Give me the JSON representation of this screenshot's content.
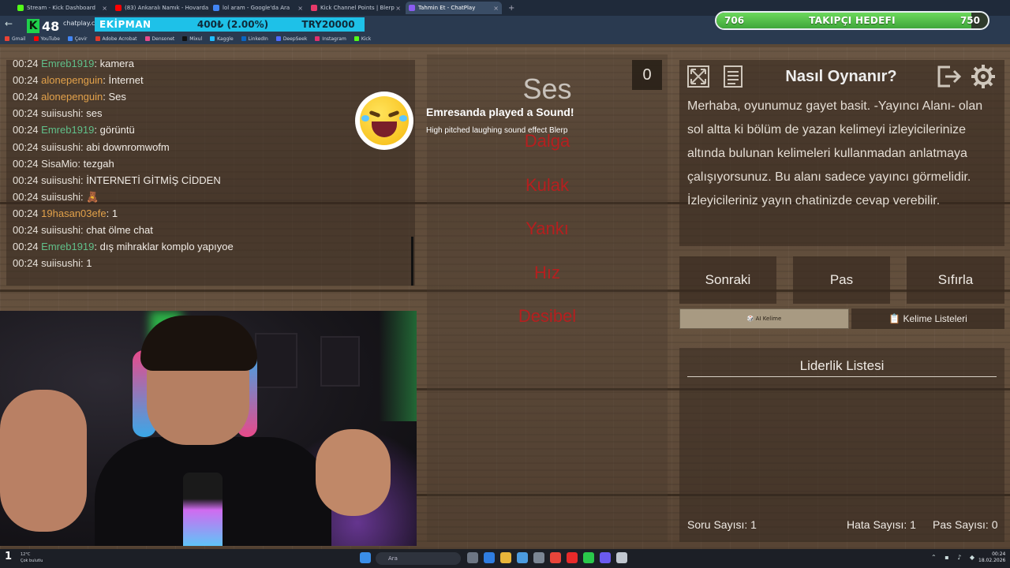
{
  "browser": {
    "tabs": [
      {
        "label": "Stream - Kick Dashboard",
        "color": "#53fc18"
      },
      {
        "label": "(83) Ankaralı Namık - Hovarda",
        "color": "#ff0000"
      },
      {
        "label": "lol aram - Google'da Ara",
        "color": "#4285f4"
      },
      {
        "label": "Kick Channel Points | Blerp",
        "color": "#e83a6a"
      },
      {
        "label": "Tahmin Et - ChatPlay",
        "color": "#8a5cf0",
        "active": true
      }
    ],
    "new_tab": "+",
    "url": "chatplay.com",
    "bookmarks": [
      {
        "label": "Gmail",
        "color": "#ea4335"
      },
      {
        "label": "YouTube",
        "color": "#ff0000"
      },
      {
        "label": "Çevir",
        "color": "#4285f4"
      },
      {
        "label": "Adobe Acrobat",
        "color": "#e03a2a"
      },
      {
        "label": "Densonet",
        "color": "#e84a8a"
      },
      {
        "label": "Mixul",
        "color": "#111111"
      },
      {
        "label": "Kaggle",
        "color": "#20beff"
      },
      {
        "label": "LinkedIn",
        "color": "#0a66c2"
      },
      {
        "label": "DeepSeek",
        "color": "#4d6bfe"
      },
      {
        "label": "Instagram",
        "color": "#e1306c"
      },
      {
        "label": "Kick",
        "color": "#53fc18"
      }
    ]
  },
  "overlay": {
    "kick_count": "48",
    "ekipman_label": "EKİPMAN",
    "ekipman_progress": "400₺ (2.00%)",
    "ekipman_goal": "TRY20000",
    "goal": {
      "current": "706",
      "caption": "TAKIPÇI HEDEFI",
      "target": "750",
      "fraction": 0.94
    }
  },
  "chat": [
    {
      "time": "00:24",
      "user": "Emreb1919",
      "color": "green",
      "text": "kamera"
    },
    {
      "time": "00:24",
      "user": "alonepenguin",
      "color": "orange",
      "text": "İnternet"
    },
    {
      "time": "00:24",
      "user": "alonepenguin",
      "color": "orange",
      "text": "Ses"
    },
    {
      "time": "00:24",
      "user": "suiisushi",
      "color": "grey",
      "text": "ses"
    },
    {
      "time": "00:24",
      "user": "Emreb1919",
      "color": "green",
      "text": "görüntü"
    },
    {
      "time": "00:24",
      "user": "suiisushi",
      "color": "grey",
      "text": "abi downromwofm"
    },
    {
      "time": "00:24",
      "user": "SisaMio",
      "color": "grey",
      "text": "tezgah"
    },
    {
      "time": "00:24",
      "user": "suiisushi",
      "color": "grey",
      "text": "İNTERNETİ GİTMİŞ CİDDEN"
    },
    {
      "time": "00:24",
      "user": "suiisushi",
      "color": "grey",
      "text": "🧸"
    },
    {
      "time": "00:24",
      "user": "19hasan03efe",
      "color": "orange",
      "text": "1"
    },
    {
      "time": "00:24",
      "user": "suiisushi",
      "color": "grey",
      "text": "chat ölme chat"
    },
    {
      "time": "00:24",
      "user": "Emreb1919",
      "color": "green",
      "text": "dış mihraklar komplo yapıyoe"
    },
    {
      "time": "00:24",
      "user": "suiisushi",
      "color": "grey",
      "text": "1"
    }
  ],
  "game": {
    "word": "Ses",
    "score": "0",
    "forbidden": [
      "Dalga",
      "Kulak",
      "Yankı",
      "Hız",
      "Desibel"
    ]
  },
  "notification": {
    "title": "Emresanda played a Sound!",
    "subtitle": "High pitched laughing sound effect Blerp"
  },
  "how_to": {
    "title": "Nasıl Oynanır?",
    "text": "Merhaba, oyunumuz gayet basit. -Yayıncı Alanı- olan sol altta ki bölüm de yazan kelimeyi izleyicilerinize altında bulunan kelimeleri kullanmadan anlatmaya çalışıyorsunuz. Bu alanı sadece yayıncı görmelidir. İzleyicileriniz yayın chatinizde cevap verebilir."
  },
  "buttons": {
    "next": "Sonraki",
    "pass": "Pas",
    "reset": "Sıfırla",
    "ai_word": "🎲 AI Kelime",
    "word_lists": "📋 Kelime Listeleri"
  },
  "leaderboard": {
    "title": "Liderlik Listesi",
    "question_count": "Soru Sayısı: 1",
    "error_count": "Hata Sayısı: 1",
    "pass_count": "Pas Sayısı: 0"
  },
  "taskbar": {
    "badge": "1",
    "temp": "12°C",
    "weather": "Çok bulutlu",
    "search": "Ara",
    "time": "00:24",
    "date": "18.02.2026"
  }
}
